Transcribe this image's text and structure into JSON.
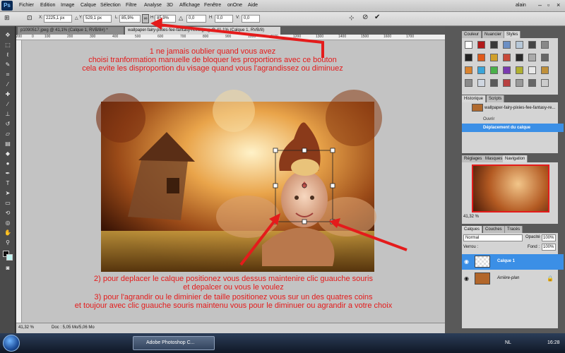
{
  "app": {
    "logo": "Ps"
  },
  "menu": [
    "Fichier",
    "Edition",
    "Image",
    "Calque",
    "Sélection",
    "Filtre",
    "Analyse",
    "3D",
    "Affichage",
    "Fenêtre",
    "onOne",
    "Aide"
  ],
  "user": "alain",
  "options": {
    "x_label": "X:",
    "x_value": "2225,1 px",
    "y_label": "Y:",
    "y_value": "529,1 px",
    "w_label": "L:",
    "w_value": "85,9%",
    "h_label": "H:",
    "h_value": "85,9%",
    "angle_label": "△",
    "angle_value": "0,0",
    "hskew_label": "H:",
    "hskew_value": "0,0",
    "vskew_label": "V:",
    "vskew_value": "0,0"
  },
  "tabs": [
    {
      "label": "p1090517.jpeg @ 41,1% (Calque 1, RVB/8#) *"
    },
    {
      "label": "wallpaper-fairy-pixies-fee-fantasy-reine.jpeg @ 41,1% (Calque 1, RVB/8)"
    }
  ],
  "ruler_ticks": [
    "-200",
    "0",
    "100",
    "200",
    "300",
    "400",
    "500",
    "600",
    "700",
    "800",
    "900",
    "1000",
    "1100",
    "1200",
    "1300",
    "1400",
    "1500",
    "1600",
    "1700"
  ],
  "status": {
    "zoom": "41,32 %",
    "doc": "Doc : 5,05 Mo/5,06 Mo"
  },
  "panels": {
    "swatch_tabs": [
      "Couleur",
      "Nuancier",
      "Styles"
    ],
    "history_tabs": [
      "Historique",
      "Scripts"
    ],
    "history_snapshot": "wallpaper-fairy-pixies-fee-fantasy-re...",
    "history_items": [
      "Ouvrir",
      "Déplacement du calque"
    ],
    "nav_tabs": [
      "Réglages",
      "Masques",
      "Navigation"
    ],
    "nav_zoom": "41,32 %",
    "layer_tabs": [
      "Calques",
      "Couches",
      "Tracés"
    ],
    "blend_mode": "Normal",
    "opacity_label": "Opacité :",
    "opacity_value": "100%",
    "lock_label": "Verrou :",
    "fill_label": "Fond :",
    "fill_value": "100%",
    "layers": [
      "Calque 1",
      "Arrière-plan"
    ]
  },
  "annotations": {
    "top_line1": "1 ne jamais oublier quand vous avez",
    "top_line2": "choisi tranformation manuelle de bloquer les proportions avec ce bouton",
    "top_line3": "cela evite les disproportion du visage quand vous l'agrandissez ou diminuez",
    "bottom_line1": "2) pour deplacer le calque positionez vous dessus maintenire clic guauche souris",
    "bottom_line2": "et depalcer ou vous le voulez",
    "bottom_line3": "3) pour l'agrandir ou le diminier de taille  positionez vous sur un des quatres coins",
    "bottom_line4": "et  toujour avec clic guauche souris maintenu vous pour le diminuer ou agrandir a votre choix"
  },
  "taskbar": {
    "ps_label": "Adobe Photoshop C...",
    "lang": "NL",
    "time": "16:28"
  },
  "colors": {
    "accent": "#e41b1b",
    "selection": "#3b8fe6",
    "panel": "#d4d4d4"
  }
}
